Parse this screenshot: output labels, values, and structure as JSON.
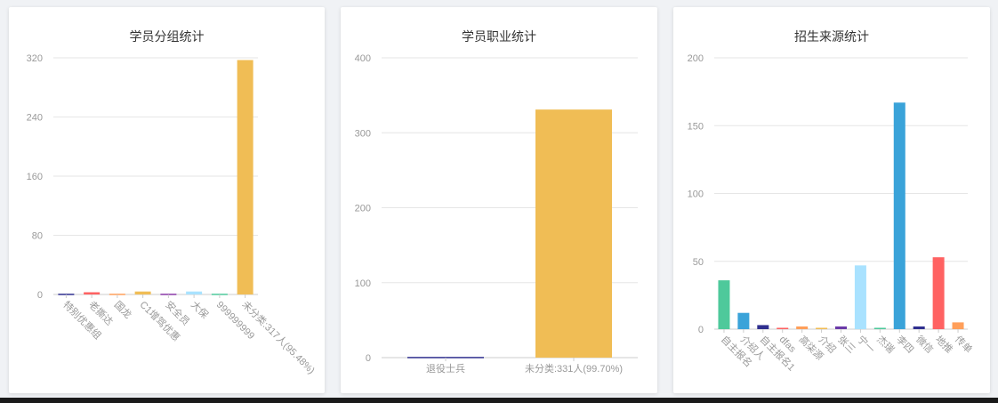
{
  "chart_data": [
    {
      "type": "bar",
      "title": "学员分组统计",
      "categories": [
        "特别优惠组",
        "老撕达",
        "国龙",
        "C1增驾优惠",
        "安全员",
        "大保",
        "999999999",
        "未分类:317人(95.48%)"
      ],
      "values": [
        1,
        3,
        1,
        4,
        1,
        4,
        1,
        317
      ],
      "colors": [
        "#2f2f8f",
        "#ff6262",
        "#ff9f5a",
        "#f0bd55",
        "#8a3aa8",
        "#a9e2ff",
        "#4ec99b",
        "#f0bd55"
      ],
      "ylim": [
        0,
        320
      ],
      "yticks": [
        0,
        80,
        160,
        240,
        320
      ],
      "label_rotate": true,
      "grid": true
    },
    {
      "type": "bar",
      "title": "学员职业统计",
      "categories": [
        "退役士兵",
        "未分类:331人(99.70%)"
      ],
      "values": [
        1,
        331
      ],
      "colors": [
        "#2f2f8f",
        "#f0bd55"
      ],
      "ylim": [
        0,
        400
      ],
      "yticks": [
        0,
        100,
        200,
        300,
        400
      ],
      "label_rotate": false,
      "grid": true
    },
    {
      "type": "bar",
      "title": "招生来源统计",
      "categories": [
        "自主报名",
        "介绍人",
        "自主报名1",
        "dfas",
        "高柒源",
        "介绍",
        "张三",
        "宁一",
        "杰瑞",
        "李四",
        "微信",
        "地推",
        "传单"
      ],
      "values": [
        36,
        12,
        3,
        1,
        2,
        1,
        2,
        47,
        1,
        167,
        2,
        53,
        5
      ],
      "colors": [
        "#4ec99b",
        "#3aa3d9",
        "#2f2f8f",
        "#ff6262",
        "#ff9f5a",
        "#f0bd55",
        "#6b3aa8",
        "#a9e2ff",
        "#4ec99b",
        "#3aa3d9",
        "#2f2f8f",
        "#ff6262",
        "#ff9f5a"
      ],
      "ylim": [
        0,
        200
      ],
      "yticks": [
        0,
        50,
        100,
        150,
        200
      ],
      "label_rotate": true,
      "grid": true
    }
  ]
}
